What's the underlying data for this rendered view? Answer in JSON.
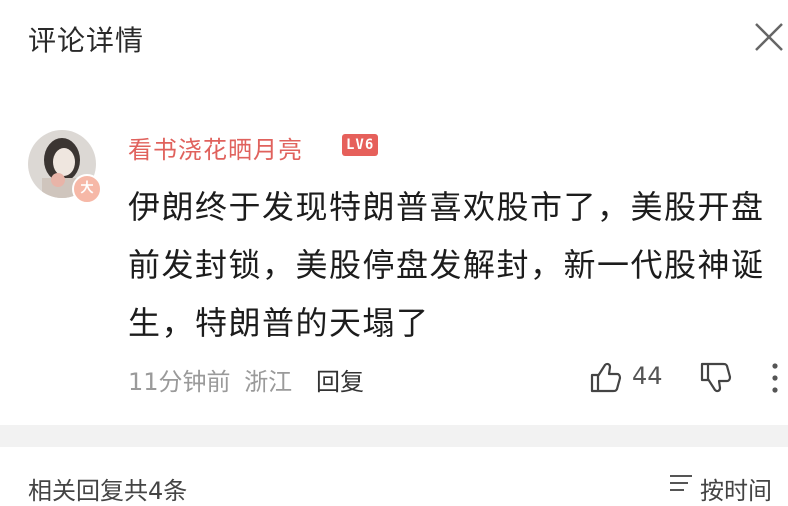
{
  "header": {
    "title": "评论详情",
    "close_icon": "close-icon"
  },
  "comment": {
    "username": "看书浇花晒月亮",
    "level": "LV6",
    "avatar_badge": "大",
    "text": "伊朗终于发现特朗普喜欢股市了，美股开盘前发封锁，美股停盘发解封，新一代股神诞生，特朗普的天塌了",
    "time": "11分钟前",
    "location": "浙江",
    "reply_label": "回复",
    "like_count": "44",
    "colors": {
      "username": "#e0625d",
      "level_tag": "#e6605b"
    }
  },
  "replies": {
    "count_label": "相关回复共4条",
    "sort_label": "按时间"
  }
}
